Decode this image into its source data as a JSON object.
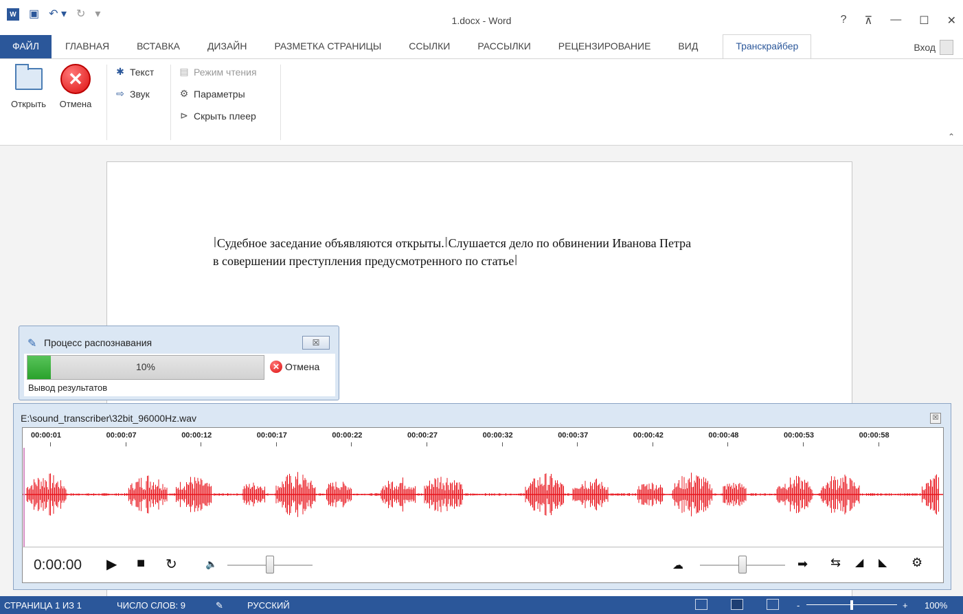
{
  "titlebar": {
    "app_icon": "W",
    "title": "1.docx - Word",
    "help": "?",
    "ribbon_display": "⊼",
    "minimize": "—",
    "maximize": "☐",
    "close": "✕"
  },
  "tabs": [
    "ФАЙЛ",
    "ГЛАВНАЯ",
    "ВСТАВКА",
    "ДИЗАЙН",
    "РАЗМЕТКА СТРАНИЦЫ",
    "ССЫЛКИ",
    "РАССЫЛКИ",
    "РЕЦЕНЗИРОВАНИЕ",
    "ВИД",
    "Транскрайбер"
  ],
  "signin": "Вход",
  "ribbon": {
    "open_label": "Открыть",
    "cancel_label": "Отмена",
    "text_label": "Текст",
    "sound_label": "Звук",
    "reading_mode_label": "Режим чтения",
    "params_label": "Параметры",
    "hide_player_label": "Скрыть плеер"
  },
  "document": {
    "line1_a": "Судебное заседание объявляются открыты.",
    "line1_b": "Слушается дело по обвинении Иванова Петра",
    "line2": "в совершении преступления предусмотренного по статье"
  },
  "recognition": {
    "title": "Процесс распознавания",
    "close": "☒",
    "progress": 0.1,
    "progress_text": "10%",
    "cancel_label": "Отмена",
    "status": "Вывод результатов"
  },
  "player": {
    "file": "E:\\sound_transcriber\\32bit_96000Hz.wav",
    "close": "☒",
    "time": "0:00:00",
    "volume_level": 0.5,
    "speed_level": 0.5,
    "wave_color": "#e8141c",
    "timeline": [
      "00:00:01",
      "00:00:07",
      "00:00:12",
      "00:00:17",
      "00:00:22",
      "00:00:27",
      "00:00:32",
      "00:00:37",
      "00:00:42",
      "00:00:48",
      "00:00:53",
      "00:00:58"
    ]
  },
  "statusbar": {
    "page": "СТРАНИЦА 1 ИЗ 1",
    "words": "ЧИСЛО СЛОВ: 9",
    "language": "РУССКИЙ",
    "zoom_minus": "-",
    "zoom_plus": "+",
    "zoom": "100%",
    "zoom_level": 0.5
  },
  "colors": {
    "word_blue": "#2b579a",
    "progress_green": "#2aa22c"
  }
}
